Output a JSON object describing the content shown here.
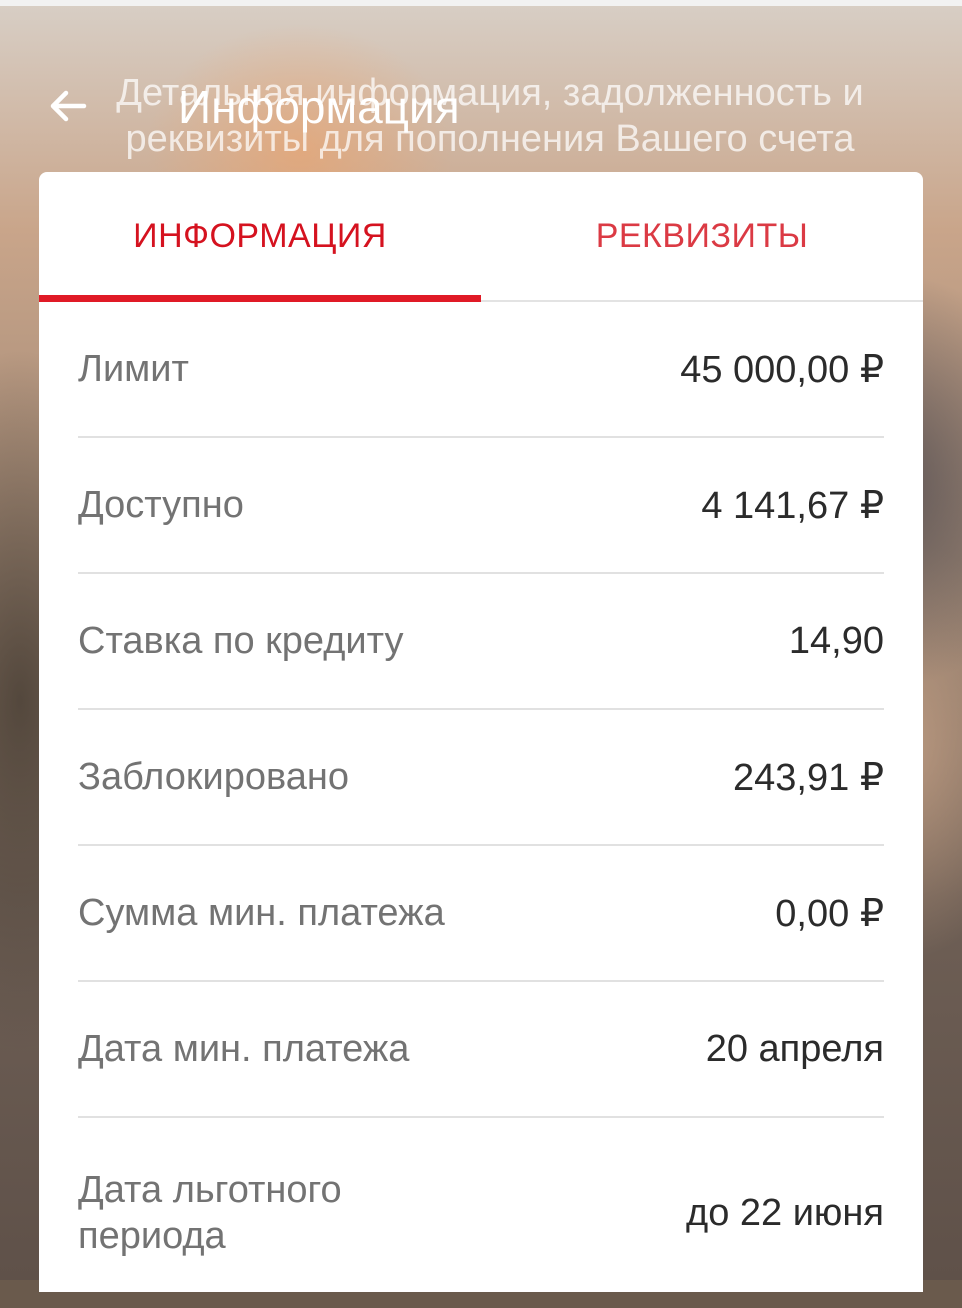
{
  "header": {
    "title": "Информация",
    "subtitle": "Детальная информация, задолженность и реквизиты для пополнения Вашего счета"
  },
  "tabs": {
    "info": "Информация",
    "requisites": "Реквизиты"
  },
  "rows": [
    {
      "label": "Лимит",
      "value": "45 000,00 ₽"
    },
    {
      "label": "Доступно",
      "value": "4 141,67 ₽"
    },
    {
      "label": "Ставка по кредиту",
      "value": "14,90"
    },
    {
      "label": "Заблокировано",
      "value": "243,91 ₽"
    },
    {
      "label": "Сумма мин. платежа",
      "value": "0,00 ₽"
    },
    {
      "label": "Дата мин. платежа",
      "value": "20 апреля"
    },
    {
      "label": "Дата льготного периода",
      "value": "до 22 июня"
    }
  ],
  "icons": {
    "back": "arrow-left-icon"
  },
  "colors": {
    "accent": "#e01a26",
    "card": "#ffffff",
    "label": "#737373",
    "value": "#2b2b2b"
  }
}
